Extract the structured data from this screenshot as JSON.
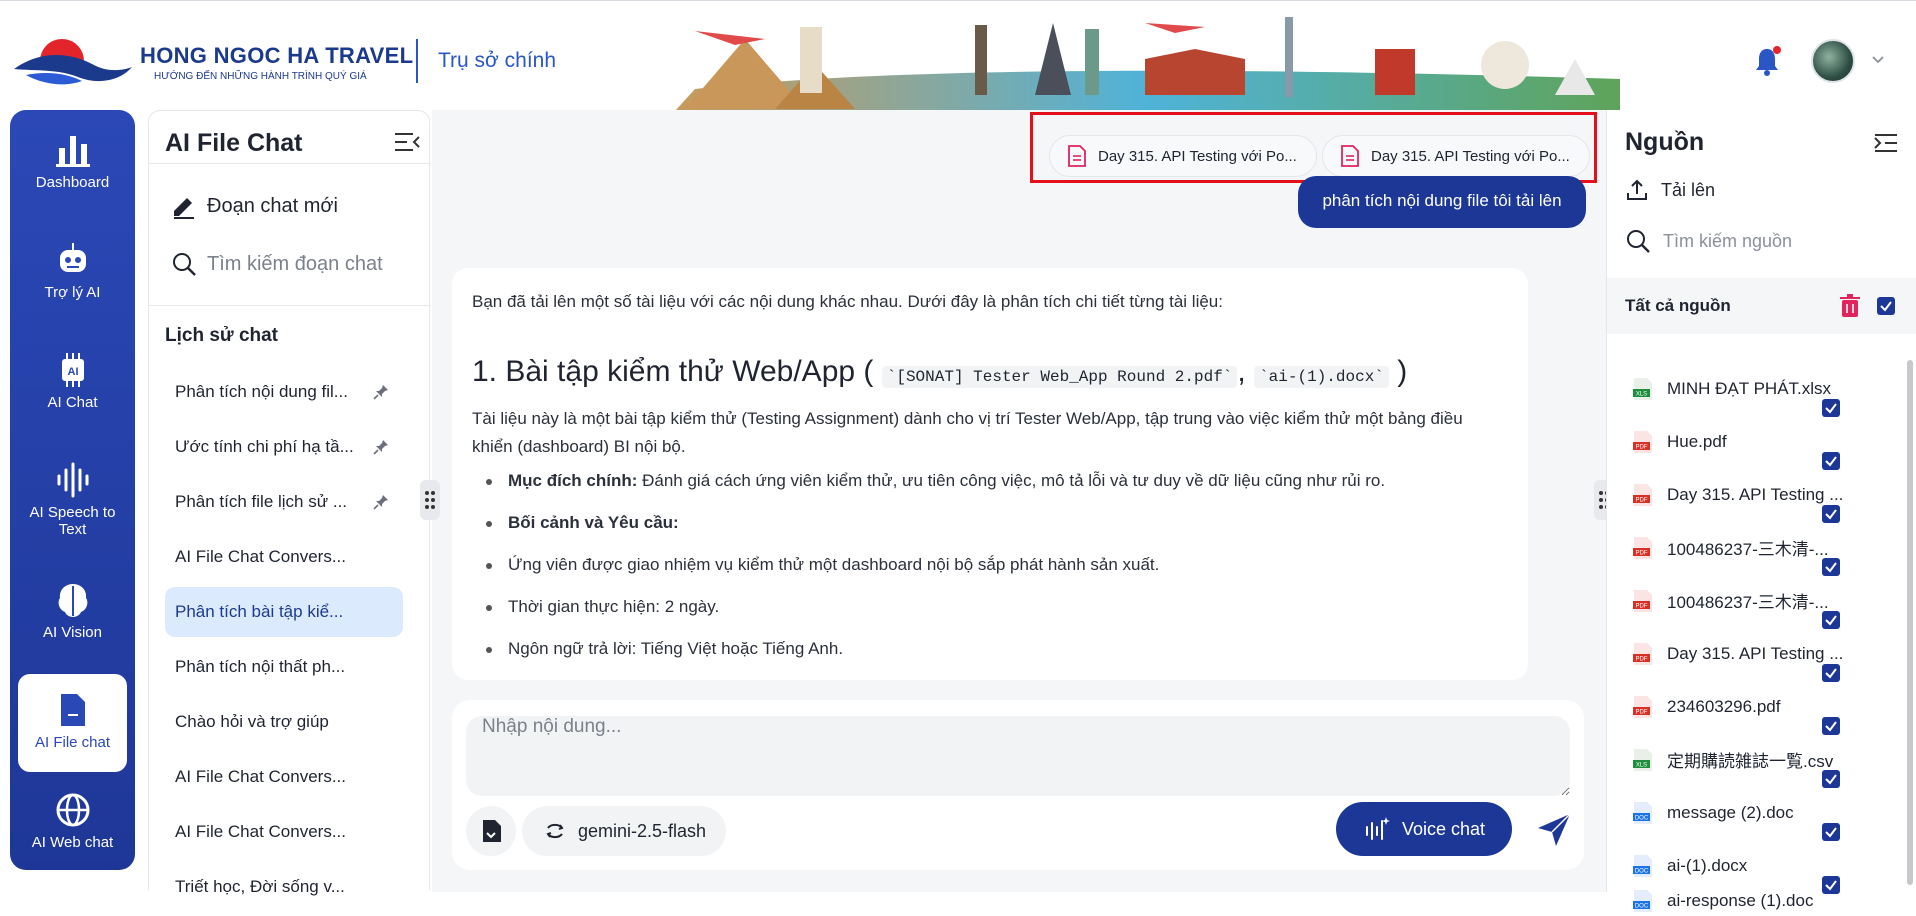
{
  "header": {
    "brand_name": "HONG NGOC HA TRAVEL",
    "brand_tagline": "HƯỚNG ĐẾN NHỮNG HÀNH TRÌNH QUÝ GIÁ",
    "office": "Trụ sở chính"
  },
  "nav": [
    {
      "label": "Dashboard",
      "icon": "bar-chart-icon"
    },
    {
      "label": "Trợ lý AI",
      "icon": "robot-icon"
    },
    {
      "label": "AI Chat",
      "icon": "chip-icon"
    },
    {
      "label": "AI Speech to Text",
      "icon": "waveform-icon"
    },
    {
      "label": "AI Vision",
      "icon": "brain-icon"
    },
    {
      "label": "AI File chat",
      "icon": "file-icon",
      "active": true
    },
    {
      "label": "AI Web chat",
      "icon": "globe-icon"
    }
  ],
  "chatlist": {
    "title": "AI File Chat",
    "new_chat": "Đoạn chat mới",
    "search_placeholder": "Tìm kiếm đoạn chat",
    "history_title": "Lịch sử chat",
    "items": [
      {
        "label": "Phân tích nội dung fil...",
        "pinned": true
      },
      {
        "label": "Ước tính chi phí hạ tầ...",
        "pinned": true
      },
      {
        "label": "Phân tích file lịch sử ...",
        "pinned": true
      },
      {
        "label": "AI File Chat Convers..."
      },
      {
        "label": "Phân tích bài tập kiể...",
        "active": true
      },
      {
        "label": "Phân tích nội thất ph..."
      },
      {
        "label": "Chào hỏi và trợ giúp"
      },
      {
        "label": "AI File Chat Convers..."
      },
      {
        "label": "AI File Chat Convers..."
      },
      {
        "label": "Triết học, Đời sống v..."
      }
    ]
  },
  "conversation": {
    "attached_files": [
      "Day 315. API Testing với Po...",
      "Day 315. API Testing với Po..."
    ],
    "user_message": "phân tích nội dung file tôi tải lên",
    "reply": {
      "intro": "Bạn đã tải lên một số tài liệu với các nội dung khác nhau. Dưới đây là phân tích chi tiết từng tài liệu:",
      "heading_prefix": "1. Bài tập kiểm thử Web/App (",
      "heading_code1": "`[SONAT] Tester Web_App Round 2.pdf`",
      "heading_sep": ",",
      "heading_code2": "`ai-(1).docx`",
      "heading_suffix": ")",
      "paragraph": "Tài liệu này là một bài tập kiểm thử (Testing Assignment) dành cho vị trí Tester Web/App, tập trung vào việc kiểm thử một bảng điều khiển (dashboard) BI nội bộ.",
      "bullet1_label": "Mục đích chính:",
      "bullet1_text": " Đánh giá cách ứng viên kiểm thử, ưu tiên công việc, mô tả lỗi và tư duy về dữ liệu cũng như rủi ro.",
      "bullet2_label": "Bối cảnh và Yêu cầu:",
      "bullet3": "Ứng viên được giao nhiệm vụ kiểm thử một dashboard nội bộ sắp phát hành sản xuất.",
      "bullet4": "Thời gian thực hiện: 2 ngày.",
      "bullet5": "Ngôn ngữ trả lời: Tiếng Việt hoặc Tiếng Anh."
    }
  },
  "composer": {
    "placeholder": "Nhập nội dung...",
    "model": "gemini-2.5-flash",
    "voice_label": "Voice chat"
  },
  "sources": {
    "title": "Nguồn",
    "upload": "Tải lên",
    "search_placeholder": "Tìm kiếm nguồn",
    "all_label": "Tất cả nguồn",
    "items": [
      {
        "name": "MINH ĐẠT PHÁT.xlsx",
        "type": "XLS",
        "color": "#1e8e3e"
      },
      {
        "name": "Hue.pdf",
        "type": "PDF",
        "color": "#d93025"
      },
      {
        "name": "Day 315. API Testing ...",
        "type": "PDF",
        "color": "#d93025"
      },
      {
        "name": "100486237-三木清-...",
        "type": "PDF",
        "color": "#d93025"
      },
      {
        "name": "100486237-三木清-...",
        "type": "PDF",
        "color": "#d93025"
      },
      {
        "name": "Day 315. API Testing ...",
        "type": "PDF",
        "color": "#d93025"
      },
      {
        "name": "234603296.pdf",
        "type": "PDF",
        "color": "#d93025"
      },
      {
        "name": "定期購読雑誌一覧.csv",
        "type": "XLS",
        "color": "#1e8e3e"
      },
      {
        "name": "message (2).doc",
        "type": "DOC",
        "color": "#1a73e8"
      },
      {
        "name": "ai-(1).docx",
        "type": "DOC",
        "color": "#1a73e8"
      },
      {
        "name": "ai-response (1).doc",
        "type": "DOC",
        "color": "#1a73e8"
      }
    ]
  },
  "colors": {
    "primary": "#1d3796",
    "highlight_box": "#e3101c",
    "active_item_bg": "#dceafd"
  }
}
